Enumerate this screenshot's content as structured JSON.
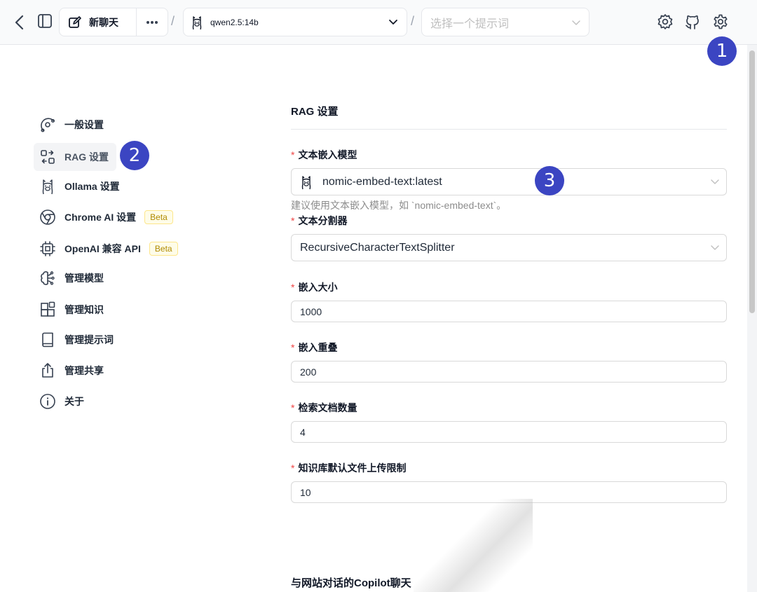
{
  "topbar": {
    "new_chat_label": "新聊天",
    "model_label": "qwen2.5:14b",
    "prompt_placeholder": "选择一个提示词",
    "separator": "/"
  },
  "callouts": [
    "1",
    "2",
    "3"
  ],
  "sidebar": {
    "items": [
      {
        "label": "一般设置",
        "icon": "orbit-settings-icon"
      },
      {
        "label": "RAG 设置",
        "icon": "rag-icon",
        "active": true
      },
      {
        "label": "Ollama 设置",
        "icon": "llama-icon"
      },
      {
        "label": "Chrome AI 设置",
        "icon": "chrome-icon",
        "badge": "Beta"
      },
      {
        "label": "OpenAI 兼容 API",
        "icon": "cpu-icon",
        "badge": "Beta"
      },
      {
        "label": "管理模型",
        "icon": "brain-icon"
      },
      {
        "label": "管理知识",
        "icon": "blocks-icon"
      },
      {
        "label": "管理提示词",
        "icon": "book-icon"
      },
      {
        "label": "管理共享",
        "icon": "share-icon"
      },
      {
        "label": "关于",
        "icon": "info-icon"
      }
    ]
  },
  "main": {
    "section_title": "RAG 设置",
    "fields": {
      "embedding_model": {
        "label": "文本嵌入模型",
        "value": "nomic-embed-text:latest",
        "helper": "建议使用文本嵌入模型，如 `nomic-embed-text`。"
      },
      "splitter": {
        "label": "文本分割器",
        "value": "RecursiveCharacterTextSplitter"
      },
      "chunk_size": {
        "label": "嵌入大小",
        "value": "1000"
      },
      "chunk_overlap": {
        "label": "嵌入重叠",
        "value": "200"
      },
      "retrieval_count": {
        "label": "检索文档数量",
        "value": "4"
      },
      "upload_limit": {
        "label": "知识库默认文件上传限制",
        "value": "10"
      }
    },
    "next_section_title": "与网站对话的Copilot聊天"
  },
  "colors": {
    "accent": "#3b45c2",
    "required": "#ef4444",
    "beta_text": "#b08b00",
    "beta_bg": "#fefce8"
  }
}
